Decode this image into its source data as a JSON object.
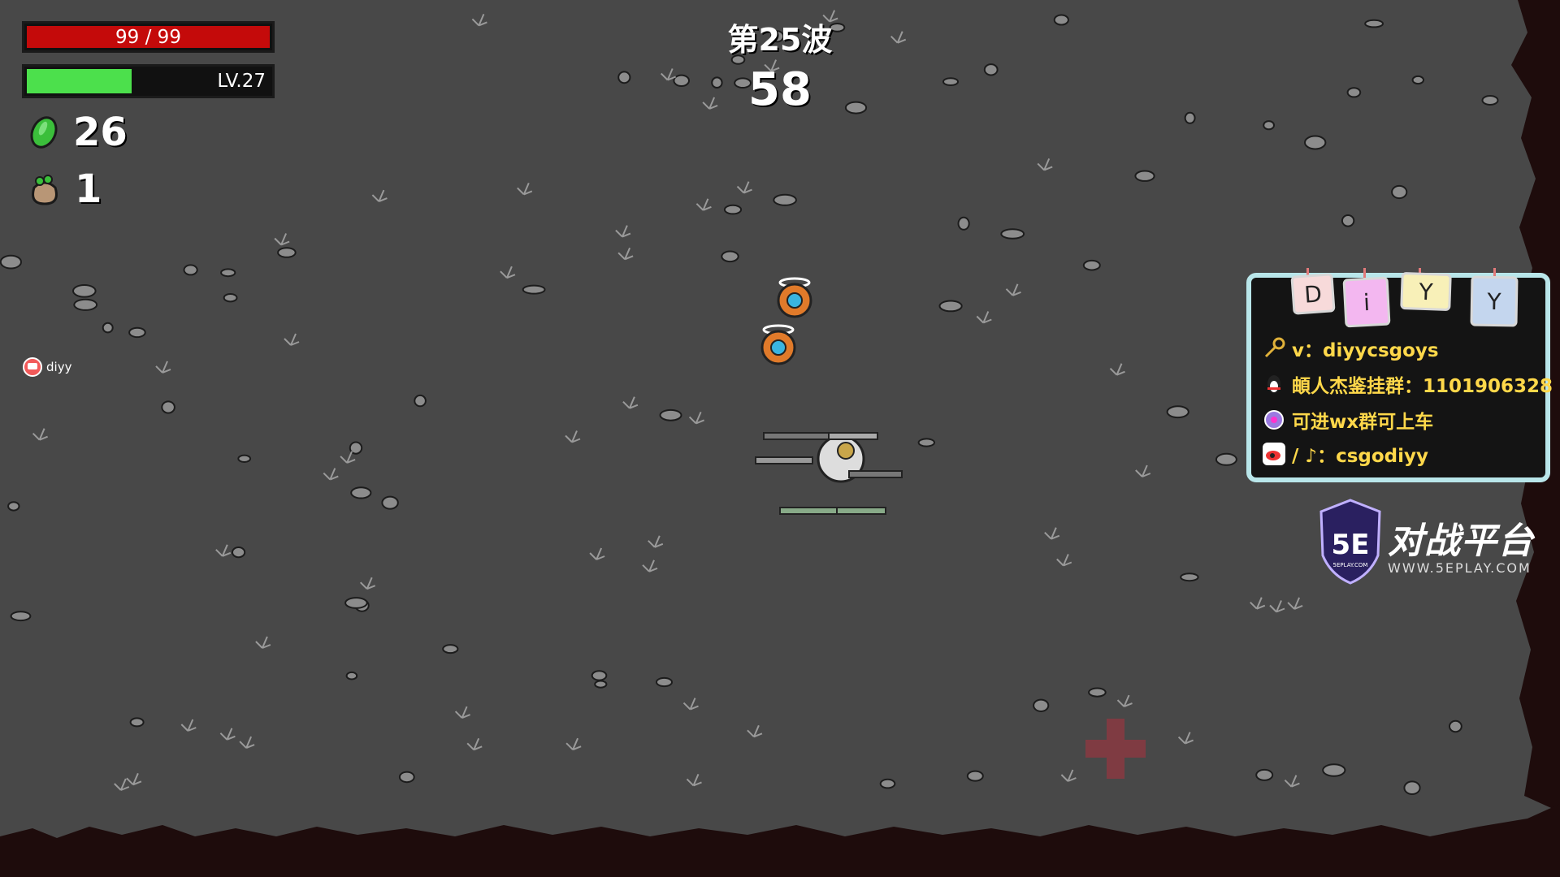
{
  "hud": {
    "hp_text": "99 / 99",
    "hp_fraction": 1.0,
    "level_text": "LV.27",
    "xp_fraction": 0.43,
    "materials_count": "26",
    "bag_count": "1"
  },
  "wave": {
    "title": "第25波",
    "timer": "58"
  },
  "player_tag": "diyy",
  "stream_panel": {
    "cards": [
      "D",
      "i",
      "Y",
      "Y"
    ],
    "lines": [
      {
        "icon": "key-icon",
        "text": "v：diyycsgoys"
      },
      {
        "icon": "qq-penguin-icon",
        "text": "頔人杰鉴挂群：1101906328"
      },
      {
        "icon": "emblem-icon",
        "text": "可进wx群可上车"
      },
      {
        "icon": "weibo-tiktok-icon",
        "text": "/ ♪：csgodiyy"
      }
    ]
  },
  "logo": {
    "badge": "5E",
    "badge_sub": "5EPLAY.COM",
    "title": "对战平台",
    "url": "WWW.5EPLAY.COM"
  },
  "colors": {
    "ground": "#484848",
    "hp": "#c40a0a",
    "xp": "#4ce04c",
    "border_dark": "#1e0c0c",
    "panel_frame": "#b9e6ea",
    "panel_text": "#ffd84a"
  }
}
